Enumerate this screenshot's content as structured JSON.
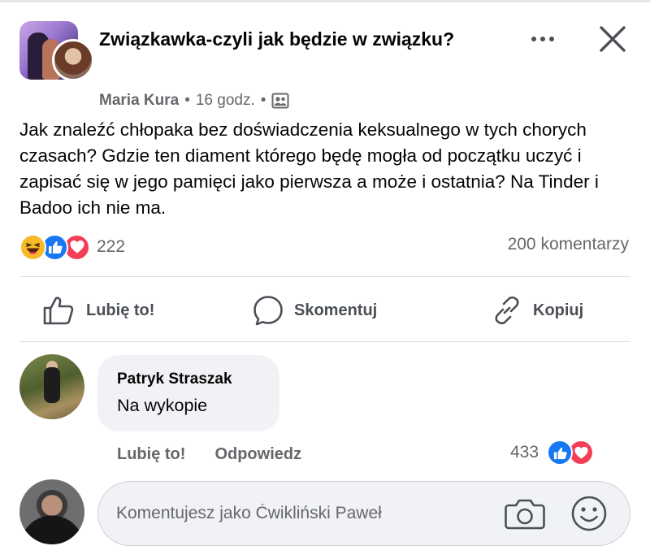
{
  "post": {
    "group_name": "Związkawka-czyli jak będzie w związku?",
    "author": "Maria Kura",
    "separator": "•",
    "time": "16 godz.",
    "audience_icon": "members-icon",
    "body": "Jak znaleźć chłopaka bez doświadczenia keksualnego w tych chorych czasach? Gdzie ten diament którego będę mogła od początku uczyć i zapisać się w jego pamięci jako pierwsza a może i ostatnia? Na Tinder i Badoo ich nie ma.",
    "reactions": [
      "haha",
      "like",
      "love"
    ],
    "reaction_count": "222",
    "comment_count": "200 komentarzy"
  },
  "actions": {
    "like": "Lubię to!",
    "comment": "Skomentuj",
    "copy": "Kopiuj"
  },
  "comment": {
    "author": "Patryk Straszak",
    "text": "Na wykopie",
    "like_label": "Lubię to!",
    "reply_label": "Odpowiedz",
    "reaction_count": "433",
    "reactions": [
      "like",
      "love"
    ]
  },
  "composer": {
    "placeholder": "Komentujesz jako Ćwikliński Paweł"
  },
  "colors": {
    "like_blue": "#1877f2",
    "love_red": "#f33e58",
    "haha_yellow": "#f7b928",
    "secondary_text": "#65676b",
    "bubble_bg": "#f0f2f5"
  }
}
